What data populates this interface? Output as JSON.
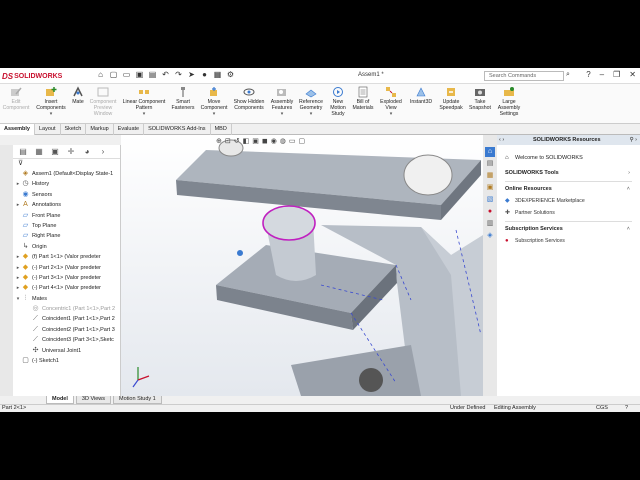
{
  "app": {
    "brand_ds": "DS",
    "brand_sw": "SOLIDWORKS",
    "doc_title": "Assem1 *",
    "search_placeholder": "Search Commands"
  },
  "ribbon": {
    "buttons": [
      {
        "label": "Edit Component",
        "icon": "edit-component-icon",
        "disabled": true
      },
      {
        "label": "Insert Components",
        "icon": "insert-components-icon",
        "disabled": false
      },
      {
        "label": "Mate",
        "icon": "mate-icon",
        "disabled": false
      },
      {
        "label": "Component Preview Window",
        "icon": "component-preview-icon",
        "disabled": true
      },
      {
        "label": "Linear Component Pattern",
        "icon": "linear-pattern-icon",
        "disabled": false
      },
      {
        "label": "Smart Fasteners",
        "icon": "smart-fasteners-icon",
        "disabled": false
      },
      {
        "label": "Move Component",
        "icon": "move-component-icon",
        "disabled": false
      },
      {
        "label": "Show Hidden Components",
        "icon": "show-hidden-icon",
        "disabled": false
      },
      {
        "label": "Assembly Features",
        "icon": "assembly-features-icon",
        "disabled": false
      },
      {
        "label": "Reference Geometry",
        "icon": "reference-geometry-icon",
        "disabled": false
      },
      {
        "label": "New Motion Study",
        "icon": "motion-study-icon",
        "disabled": false
      },
      {
        "label": "Bill of Materials",
        "icon": "bom-icon",
        "disabled": false
      },
      {
        "label": "Exploded View",
        "icon": "exploded-view-icon",
        "disabled": false
      },
      {
        "label": "Instant3D",
        "icon": "instant3d-icon",
        "disabled": false
      },
      {
        "label": "Update Speedpak",
        "icon": "speedpak-icon",
        "disabled": false
      },
      {
        "label": "Take Snapshot",
        "icon": "snapshot-icon",
        "disabled": false
      },
      {
        "label": "Large Assembly Settings",
        "icon": "large-assembly-icon",
        "disabled": false
      }
    ]
  },
  "cm_tabs": [
    "Assembly",
    "Layout",
    "Sketch",
    "Markup",
    "Evaluate",
    "SOLIDWORKS Add-Ins",
    "MBD"
  ],
  "tree": [
    {
      "label": "Assem1  (Default<Display State-1",
      "toggle": "",
      "icon": "assembly-icon"
    },
    {
      "label": "History",
      "toggle": "▸",
      "icon": "history-icon"
    },
    {
      "label": "Sensors",
      "toggle": "",
      "icon": "sensors-icon"
    },
    {
      "label": "Annotations",
      "toggle": "▸",
      "icon": "annotations-icon"
    },
    {
      "label": "Front Plane",
      "toggle": "",
      "icon": "plane-icon"
    },
    {
      "label": "Top Plane",
      "toggle": "",
      "icon": "plane-icon"
    },
    {
      "label": "Right Plane",
      "toggle": "",
      "icon": "plane-icon"
    },
    {
      "label": "Origin",
      "toggle": "",
      "icon": "origin-icon"
    },
    {
      "label": "(f) Part 1<1> (Valor predeter",
      "toggle": "▸",
      "icon": "part-icon"
    },
    {
      "label": "(-) Part 2<1> (Valor predeter",
      "toggle": "▸",
      "icon": "part-icon"
    },
    {
      "label": "(-) Part 3<1> (Valor predeter",
      "toggle": "▸",
      "icon": "part-icon"
    },
    {
      "label": "(-) Part 4<1> (Valor predeter",
      "toggle": "▸",
      "icon": "part-icon"
    },
    {
      "label": "Mates",
      "toggle": "▾",
      "icon": "mates-icon"
    },
    {
      "label": "Concentric1 (Part 1<1>,Part 2",
      "toggle": "",
      "icon": "concentric-icon",
      "grey": true
    },
    {
      "label": "Coincident1 (Part 1<1>,Part 2",
      "toggle": "",
      "icon": "coincident-icon"
    },
    {
      "label": "Coincident2 (Part 1<1>,Part 3",
      "toggle": "",
      "icon": "coincident-icon"
    },
    {
      "label": "Coincident3 (Part 3<1>,Sketc",
      "toggle": "",
      "icon": "coincident-icon"
    },
    {
      "label": "Universal Joint1",
      "toggle": "",
      "icon": "universal-joint-icon"
    },
    {
      "label": "(-) Sketch1",
      "toggle": "",
      "icon": "sketch-icon"
    }
  ],
  "bottom_tabs": [
    "Model",
    "3D Views",
    "Motion Study 1"
  ],
  "taskpane": {
    "title": "SOLIDWORKS Resources",
    "welcome": "Welcome to SOLIDWORKS",
    "tools": "SOLIDWORKS Tools",
    "online_resources": "Online Resources",
    "marketplace": "3DEXPERIENCE Marketplace",
    "partner": "Partner Solutions",
    "subscription_services": "Subscription Services",
    "subscription_link": "Subscription Services"
  },
  "status": {
    "left": "Part 2<1>",
    "state": "Under Defined",
    "mode": "Editing Assembly",
    "units": "CGS"
  },
  "colors": {
    "accent": "#c8102e",
    "selection": "#c020c0",
    "part_face": "#9ba3ad"
  }
}
